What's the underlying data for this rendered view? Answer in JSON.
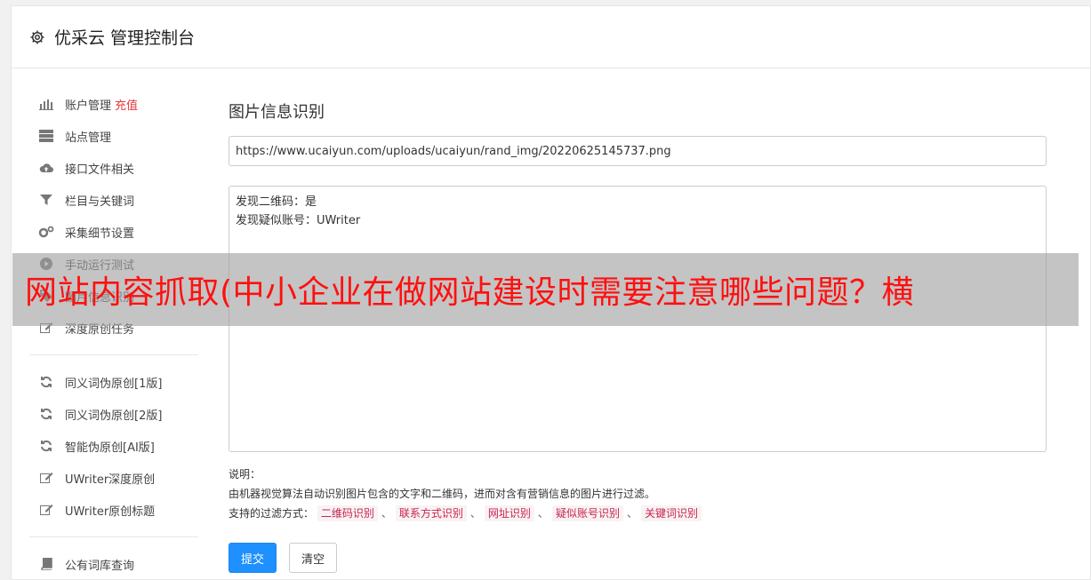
{
  "header": {
    "title": "优采云 管理控制台"
  },
  "sidebar": {
    "group1": [
      {
        "icon": "bar-chart-icon",
        "label": "账户管理",
        "badge": "充值"
      },
      {
        "icon": "server-icon",
        "label": "站点管理"
      },
      {
        "icon": "cloud-upload-icon",
        "label": "接口文件相关"
      },
      {
        "icon": "filter-icon",
        "label": "栏目与关键词"
      },
      {
        "icon": "gears-icon",
        "label": "采集细节设置"
      },
      {
        "icon": "play-circle-icon",
        "label": "手动运行测试"
      },
      {
        "icon": "tag-icon",
        "label": "图片信息识别"
      },
      {
        "icon": "edit-icon",
        "label": "深度原创任务"
      }
    ],
    "group2": [
      {
        "icon": "refresh-icon",
        "label": "同义词伪原创[1版]"
      },
      {
        "icon": "refresh-icon",
        "label": "同义词伪原创[2版]"
      },
      {
        "icon": "refresh-icon",
        "label": "智能伪原创[AI版]"
      },
      {
        "icon": "edit-icon",
        "label": "UWriter深度原创"
      },
      {
        "icon": "edit-icon",
        "label": "UWriter原创标题"
      }
    ],
    "group3": [
      {
        "icon": "book-icon",
        "label": "公有词库查询"
      }
    ]
  },
  "main": {
    "title": "图片信息识别",
    "url_value": "https://www.ucaiyun.com/uploads/ucaiyun/rand_img/20220625145737.png",
    "result_lines": [
      "发现二维码：是",
      "发现疑似账号：UWriter"
    ],
    "notes_label": "说明：",
    "notes_text": "由机器视觉算法自动识别图片包含的文字和二维码，进而对含有营销信息的图片进行过滤。",
    "filter_prefix": "支持的过滤方式：",
    "filters": [
      "二维码识别",
      "联系方式识别",
      "网址识别",
      "疑似账号识别",
      "关键词识别"
    ],
    "filter_separator": "、",
    "submit_label": "提交",
    "clear_label": "清空"
  },
  "banner": {
    "text": "网站内容抓取(中小企业在做网站建设时需要注意哪些问题？横"
  },
  "colors": {
    "primary": "#1e90ff",
    "recharge": "#e4393c",
    "tag_text": "#c7254e",
    "banner_text": "#ff1010"
  }
}
